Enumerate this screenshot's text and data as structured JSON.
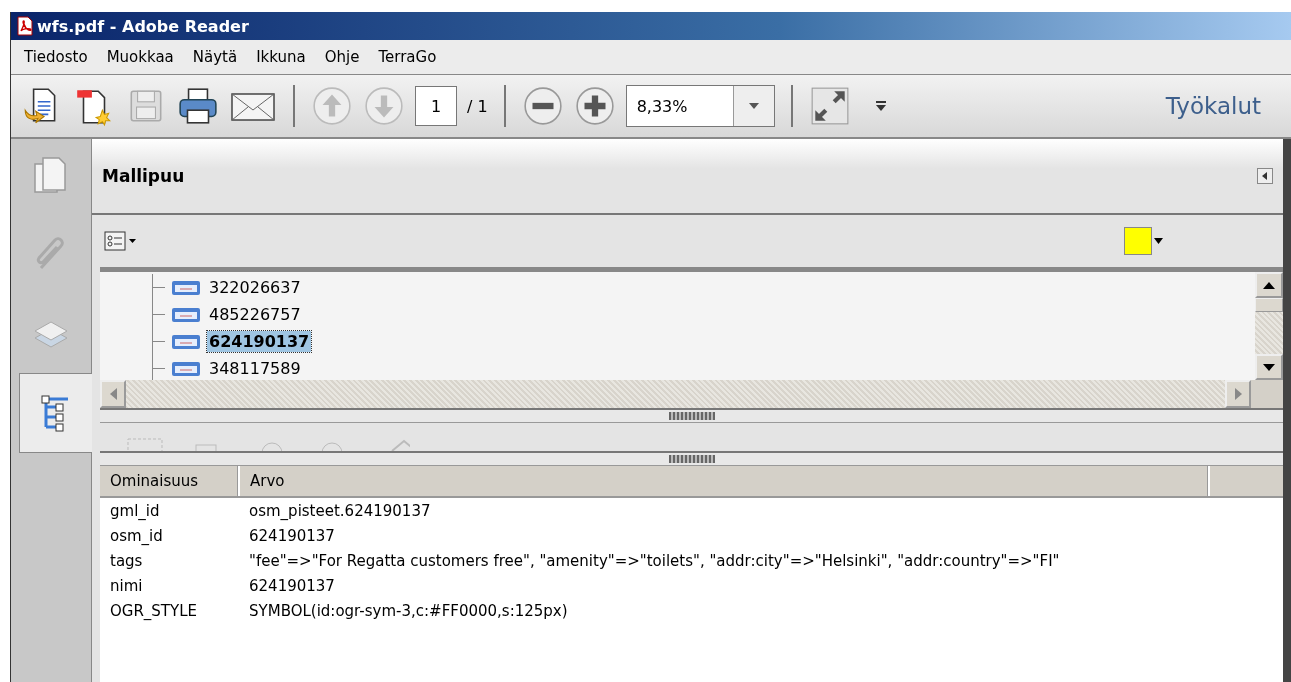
{
  "window": {
    "title": "wfs.pdf - Adobe Reader"
  },
  "menu": [
    "Tiedosto",
    "Muokkaa",
    "Näytä",
    "Ikkuna",
    "Ohje",
    "TerraGo"
  ],
  "toolbar": {
    "page": "1",
    "page_total": "/ 1",
    "zoom": "8,33%",
    "tools_label": "Työkalut"
  },
  "sidebar": [
    {
      "kind": "pages",
      "selected": false
    },
    {
      "kind": "attachments",
      "selected": false
    },
    {
      "kind": "layers",
      "selected": false
    },
    {
      "kind": "tree",
      "selected": true
    }
  ],
  "panel": {
    "title": "Mallipuu"
  },
  "tree": [
    {
      "label": "322026637",
      "selected": false
    },
    {
      "label": "485226757",
      "selected": false
    },
    {
      "label": "624190137",
      "selected": true
    },
    {
      "label": "348117589",
      "selected": false
    }
  ],
  "table": {
    "columns": [
      "Ominaisuus",
      "Arvo"
    ],
    "rows": [
      [
        "gml_id",
        "osm_pisteet.624190137"
      ],
      [
        "osm_id",
        "624190137"
      ],
      [
        "tags",
        "\"fee\"=>\"For Regatta customers free\", \"amenity\"=>\"toilets\", \"addr:city\"=>\"Helsinki\", \"addr:country\"=>\"FI\""
      ],
      [
        "nimi",
        "624190137"
      ],
      [
        "OGR_STYLE",
        "SYMBOL(id:ogr-sym-3,c:#FF0000,s:125px)"
      ]
    ]
  }
}
